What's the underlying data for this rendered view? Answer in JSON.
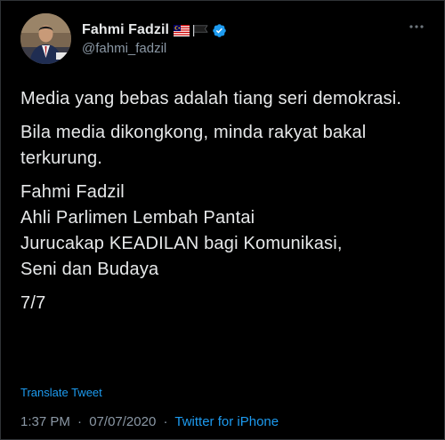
{
  "author": {
    "display_name": "Fahmi Fadzil",
    "handle": "@fahmi_fadzil",
    "flag_icon": "malaysia-flag-icon",
    "second_flag_icon": "black-flag-icon",
    "verified_icon": "verified-badge-icon"
  },
  "tweet": {
    "paragraphs": [
      "Media yang bebas adalah tiang seri demokrasi.",
      "Bila media dikongkong, minda rakyat bakal terkurung."
    ],
    "signature_lines": [
      "Fahmi Fadzil",
      "Ahli Parlimen Lembah Pantai",
      "Jurucakap KEADILAN bagi Komunikasi,",
      "Seni dan Budaya"
    ],
    "thread_counter": "7/7"
  },
  "translate_label": "Translate Tweet",
  "meta": {
    "time": "1:37 PM",
    "date": "07/07/2020",
    "separator": "·",
    "source": "Twitter for iPhone"
  },
  "colors": {
    "background": "#000000",
    "text": "#e7e9ea",
    "secondary_text": "#8b98a5",
    "accent": "#1d9bf0"
  }
}
